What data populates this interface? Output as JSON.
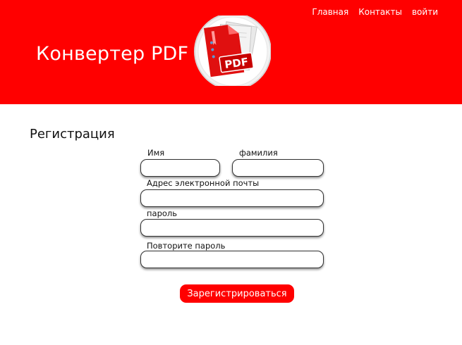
{
  "header": {
    "title": "Конвертер PDF",
    "nav": [
      "Главная",
      "Контакты",
      "войти"
    ],
    "logo_text": "PDF",
    "logo_icon": "pdf-document-icon"
  },
  "form": {
    "title": "Регистрация",
    "first_name_label": "Имя",
    "first_name_value": "",
    "last_name_label": "фамилия",
    "last_name_value": "",
    "email_label": "Адрес электронной почты",
    "email_value": "",
    "password_label": "пароль",
    "password_value": "",
    "confirm_label": "Повторите пароль",
    "confirm_value": "",
    "submit_label": "Зарегистрироваться"
  },
  "colors": {
    "accent": "#ff0000",
    "header_text": "#ffffff"
  }
}
